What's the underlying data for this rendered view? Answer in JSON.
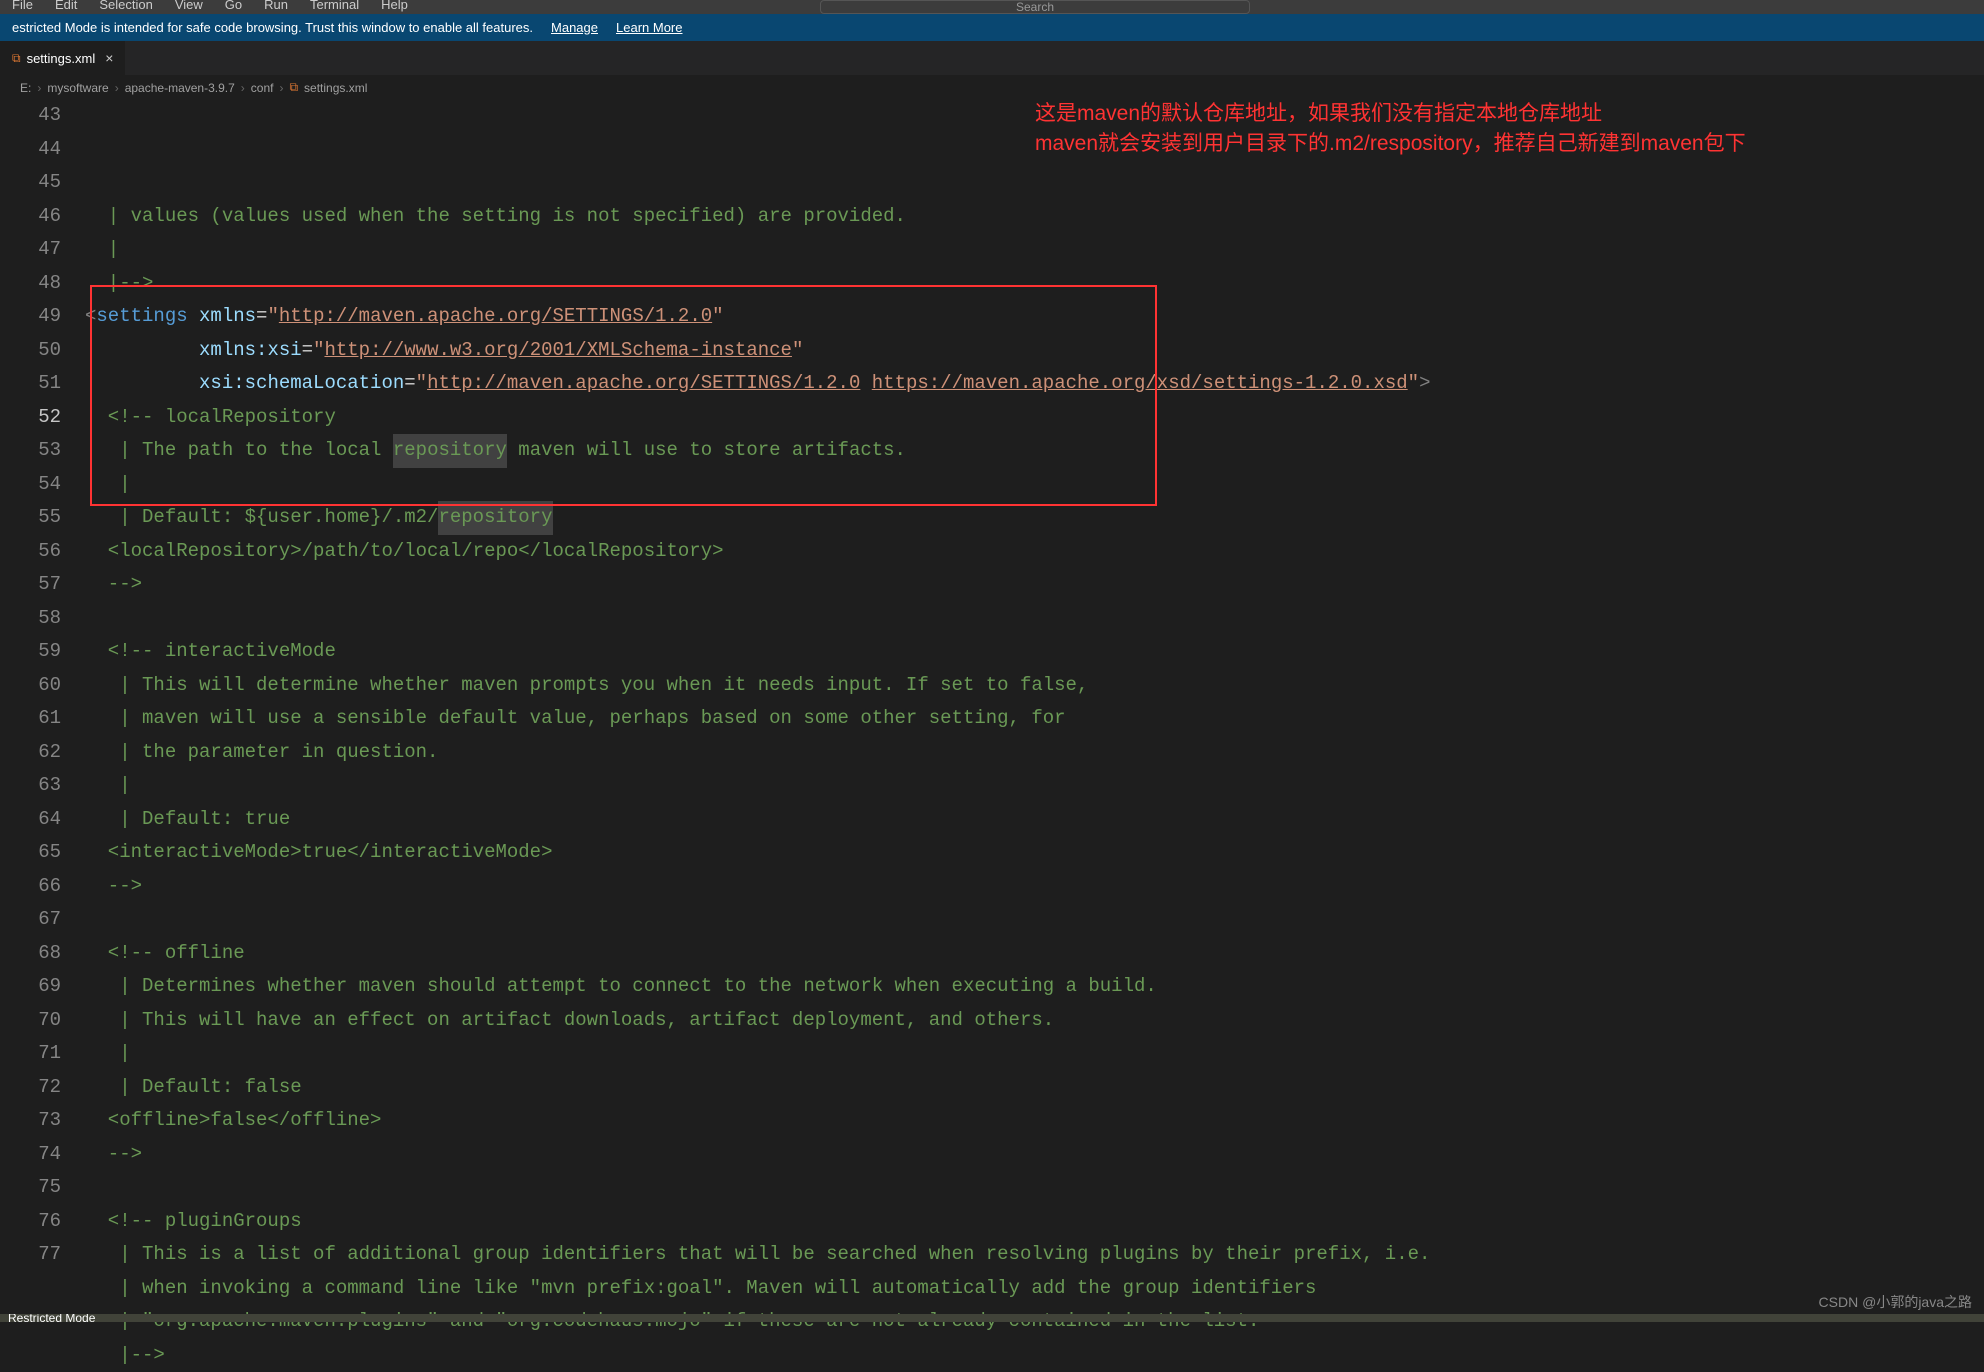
{
  "menu": {
    "items": [
      "File",
      "Edit",
      "Selection",
      "View",
      "Go",
      "Run",
      "Terminal",
      "Help"
    ]
  },
  "search": {
    "placeholder": "Search"
  },
  "notification": {
    "text": "estricted Mode is intended for safe code browsing. Trust this window to enable all features.",
    "manage": "Manage",
    "learn": "Learn More"
  },
  "tab": {
    "label": "settings.xml",
    "icon": "xml-icon"
  },
  "breadcrumb": {
    "parts": [
      "E:",
      "mysoftware",
      "apache-maven-3.9.7",
      "conf",
      "settings.xml"
    ]
  },
  "annotation": {
    "line1": "这是maven的默认仓库地址，如果我们没有指定本地仓库地址",
    "line2": "maven就会安装到用户目录下的.m2/respository，推荐自己新建到maven包下"
  },
  "editor": {
    "startLine": 43,
    "currentLine": 52,
    "lines": [
      {
        "n": 43,
        "segs": [
          {
            "t": "  | values (values used when the setting is not specified) are provided.",
            "cls": "c-comment"
          }
        ]
      },
      {
        "n": 44,
        "segs": [
          {
            "t": "  |",
            "cls": "c-comment"
          }
        ]
      },
      {
        "n": 45,
        "segs": [
          {
            "t": "  |-->",
            "cls": "c-comment"
          }
        ]
      },
      {
        "n": 46,
        "segs": [
          {
            "t": "<",
            "cls": "c-punct"
          },
          {
            "t": "settings",
            "cls": "c-tag"
          },
          {
            "t": " ",
            "cls": ""
          },
          {
            "t": "xmlns",
            "cls": "c-attr"
          },
          {
            "t": "=",
            "cls": "c-text"
          },
          {
            "t": "\"",
            "cls": "c-string"
          },
          {
            "t": "http://maven.apache.org/SETTINGS/1.2.0",
            "cls": "c-string underline"
          },
          {
            "t": "\"",
            "cls": "c-string"
          }
        ]
      },
      {
        "n": 47,
        "segs": [
          {
            "t": "          ",
            "cls": ""
          },
          {
            "t": "xmlns:xsi",
            "cls": "c-attr"
          },
          {
            "t": "=",
            "cls": "c-text"
          },
          {
            "t": "\"",
            "cls": "c-string"
          },
          {
            "t": "http://www.w3.org/2001/XMLSchema-instance",
            "cls": "c-string underline"
          },
          {
            "t": "\"",
            "cls": "c-string"
          }
        ]
      },
      {
        "n": 48,
        "segs": [
          {
            "t": "          ",
            "cls": ""
          },
          {
            "t": "xsi:schemaLocation",
            "cls": "c-attr"
          },
          {
            "t": "=",
            "cls": "c-text"
          },
          {
            "t": "\"",
            "cls": "c-string"
          },
          {
            "t": "http://maven.apache.org/SETTINGS/1.2.0",
            "cls": "c-string underline"
          },
          {
            "t": " ",
            "cls": "c-string"
          },
          {
            "t": "https://maven.apache.org/xsd/settings-1.2.0.xsd",
            "cls": "c-string underline"
          },
          {
            "t": "\"",
            "cls": "c-string"
          },
          {
            "t": ">",
            "cls": "c-punct"
          }
        ]
      },
      {
        "n": 49,
        "segs": [
          {
            "t": "  <!-- localRepository",
            "cls": "c-comment"
          }
        ]
      },
      {
        "n": 50,
        "segs": [
          {
            "t": "   | The path to the local ",
            "cls": "c-comment"
          },
          {
            "t": "repository",
            "cls": "c-comment hl"
          },
          {
            "t": " maven will use to store artifacts.",
            "cls": "c-comment"
          }
        ]
      },
      {
        "n": 51,
        "segs": [
          {
            "t": "   |",
            "cls": "c-comment"
          }
        ]
      },
      {
        "n": 52,
        "segs": [
          {
            "t": "   | Default: ${user.home}/.m2/",
            "cls": "c-comment"
          },
          {
            "t": "repository",
            "cls": "c-comment hl"
          }
        ]
      },
      {
        "n": 53,
        "segs": [
          {
            "t": "  <localRepository>/path/to/local/repo</localRepository>",
            "cls": "c-comment"
          }
        ]
      },
      {
        "n": 54,
        "segs": [
          {
            "t": "  -->",
            "cls": "c-comment"
          }
        ]
      },
      {
        "n": 55,
        "segs": []
      },
      {
        "n": 56,
        "segs": [
          {
            "t": "  <!-- interactiveMode",
            "cls": "c-comment"
          }
        ]
      },
      {
        "n": 57,
        "segs": [
          {
            "t": "   | This will determine whether maven prompts you when it needs input. If set to false,",
            "cls": "c-comment"
          }
        ]
      },
      {
        "n": 58,
        "segs": [
          {
            "t": "   | maven will use a sensible default value, perhaps based on some other setting, for",
            "cls": "c-comment"
          }
        ]
      },
      {
        "n": 59,
        "segs": [
          {
            "t": "   | the parameter in question.",
            "cls": "c-comment"
          }
        ]
      },
      {
        "n": 60,
        "segs": [
          {
            "t": "   |",
            "cls": "c-comment"
          }
        ]
      },
      {
        "n": 61,
        "segs": [
          {
            "t": "   | Default: true",
            "cls": "c-comment"
          }
        ]
      },
      {
        "n": 62,
        "segs": [
          {
            "t": "  <interactiveMode>true</interactiveMode>",
            "cls": "c-comment"
          }
        ]
      },
      {
        "n": 63,
        "segs": [
          {
            "t": "  -->",
            "cls": "c-comment"
          }
        ]
      },
      {
        "n": 64,
        "segs": []
      },
      {
        "n": 65,
        "segs": [
          {
            "t": "  <!-- offline",
            "cls": "c-comment"
          }
        ]
      },
      {
        "n": 66,
        "segs": [
          {
            "t": "   | Determines whether maven should attempt to connect to the network when executing a build.",
            "cls": "c-comment"
          }
        ]
      },
      {
        "n": 67,
        "segs": [
          {
            "t": "   | This will have an effect on artifact downloads, artifact deployment, and others.",
            "cls": "c-comment"
          }
        ]
      },
      {
        "n": 68,
        "segs": [
          {
            "t": "   |",
            "cls": "c-comment"
          }
        ]
      },
      {
        "n": 69,
        "segs": [
          {
            "t": "   | Default: false",
            "cls": "c-comment"
          }
        ]
      },
      {
        "n": 70,
        "segs": [
          {
            "t": "  <offline>false</offline>",
            "cls": "c-comment"
          }
        ]
      },
      {
        "n": 71,
        "segs": [
          {
            "t": "  -->",
            "cls": "c-comment"
          }
        ]
      },
      {
        "n": 72,
        "segs": []
      },
      {
        "n": 73,
        "segs": [
          {
            "t": "  <!-- pluginGroups",
            "cls": "c-comment"
          }
        ]
      },
      {
        "n": 74,
        "segs": [
          {
            "t": "   | This is a list of additional group identifiers that will be searched when resolving plugins by their prefix, i.e.",
            "cls": "c-comment"
          }
        ]
      },
      {
        "n": 75,
        "segs": [
          {
            "t": "   | when invoking a command line like \"mvn prefix:goal\". Maven will automatically add the group identifiers",
            "cls": "c-comment"
          }
        ]
      },
      {
        "n": 76,
        "segs": [
          {
            "t": "   | \"org.apache.maven.plugins\" and \"org.codehaus.mojo\" if these are not already contained in the list.",
            "cls": "c-comment"
          }
        ]
      },
      {
        "n": 77,
        "segs": [
          {
            "t": "   |-->",
            "cls": "c-comment"
          }
        ]
      }
    ]
  },
  "watermark": "CSDN @小郭的java之路",
  "status": {
    "mode": "Restricted Mode"
  }
}
